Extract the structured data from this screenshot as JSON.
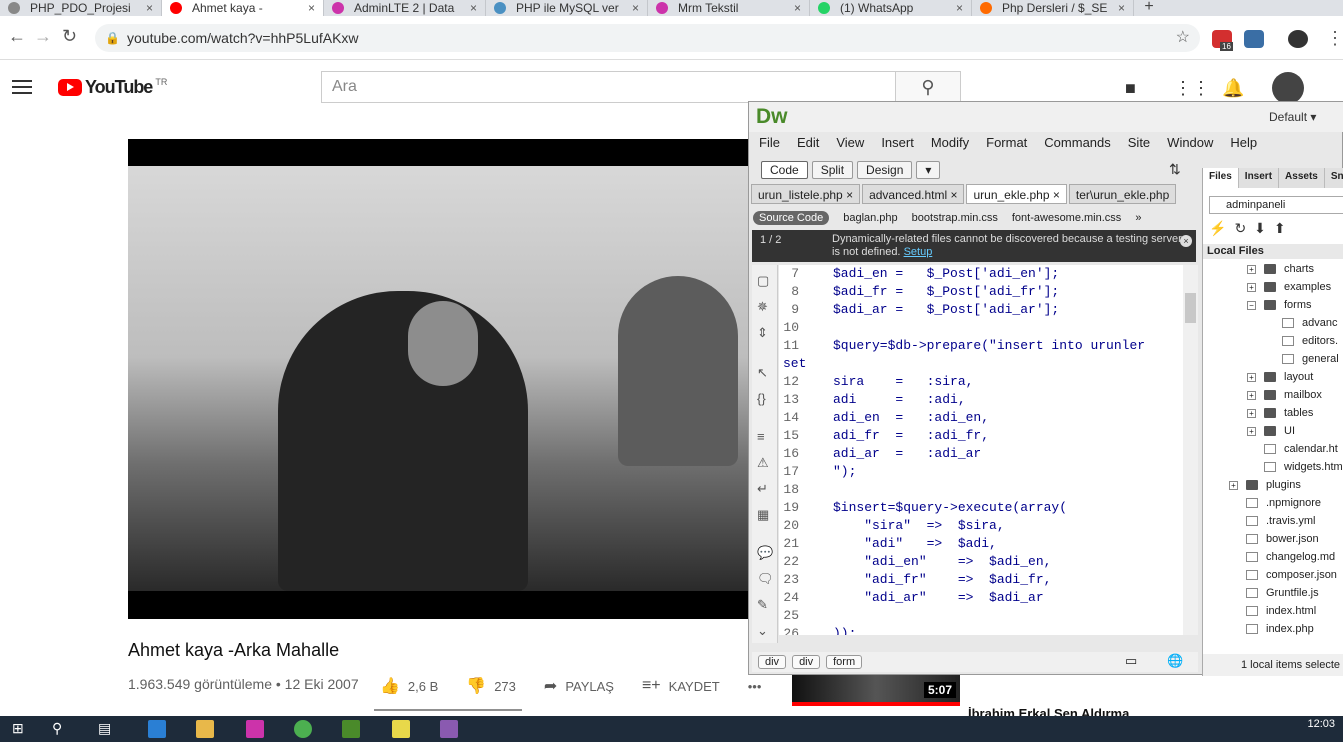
{
  "browser": {
    "tabs": [
      {
        "label": "PHP_PDO_Projesi",
        "color": "#888888",
        "active": false
      },
      {
        "label": "Ahmet kaya -",
        "color": "#ff0000",
        "active": true
      },
      {
        "label": "AdminLTE 2 | Data",
        "color": "#cc33aa",
        "active": false
      },
      {
        "label": "PHP ile MySQL ver",
        "color": "#4a90c2",
        "active": false
      },
      {
        "label": "Mrm Tekstil",
        "color": "#cc33aa",
        "active": false
      },
      {
        "label": "(1) WhatsApp",
        "color": "#25d366",
        "active": false
      },
      {
        "label": "Php Dersleri / $_SE",
        "color": "#ff6a00",
        "active": false
      }
    ],
    "new_tab": "+",
    "url": "youtube.com/watch?v=hhP5LufAKxw",
    "extension_badge": "16"
  },
  "youtube": {
    "logo": "YouTube",
    "country": "TR",
    "search_placeholder": "Ara",
    "video_title": "Ahmet kaya -Arka Mahalle",
    "views_date": "1.963.549 görüntüleme • 12 Eki 2007",
    "likes": "2,6 B",
    "dislikes": "273",
    "share": "PAYLAŞ",
    "save": "KAYDET",
    "more": "•••",
    "rec_duration": "5:07",
    "rec_title": "İbrahim Erkal Sen Aldırma"
  },
  "dreamweaver": {
    "logo": "Dw",
    "workspace": "Default",
    "menu": [
      "File",
      "Edit",
      "View",
      "Insert",
      "Modify",
      "Format",
      "Commands",
      "Site",
      "Window",
      "Help"
    ],
    "views": [
      "Code",
      "Split",
      "Design"
    ],
    "file_tabs": [
      "urun_listele.php",
      "advanced.html",
      "urun_ekle.php",
      "ter\\urun_ekle.php"
    ],
    "source_code": "Source Code",
    "related_files": [
      "baglan.php",
      "bootstrap.min.css",
      "font-awesome.min.css"
    ],
    "info_page": "1 / 2",
    "info_text": "Dynamically-related files cannot be discovered because a testing server is not defined.",
    "info_link": "Setup",
    "code_lines": [
      {
        "n": "7",
        "t": "$adi_en =   $_Post['adi_en'];"
      },
      {
        "n": "8",
        "t": "$adi_fr =   $_Post['adi_fr'];"
      },
      {
        "n": "9",
        "t": "$adi_ar =   $_Post['adi_ar'];"
      },
      {
        "n": "10",
        "t": ""
      },
      {
        "n": "11",
        "t": "$query=$db->prepare(\"insert into urunler"
      },
      {
        "n": "",
        "t": "set"
      },
      {
        "n": "12",
        "t": "sira    =   :sira,"
      },
      {
        "n": "13",
        "t": "adi     =   :adi,"
      },
      {
        "n": "14",
        "t": "adi_en  =   :adi_en,"
      },
      {
        "n": "15",
        "t": "adi_fr  =   :adi_fr,"
      },
      {
        "n": "16",
        "t": "adi_ar  =   :adi_ar"
      },
      {
        "n": "17",
        "t": "\");"
      },
      {
        "n": "18",
        "t": ""
      },
      {
        "n": "19",
        "t": "$insert=$query->execute(array("
      },
      {
        "n": "20",
        "t": "    \"sira\"  =>  $sira,"
      },
      {
        "n": "21",
        "t": "    \"adi\"   =>  $adi,"
      },
      {
        "n": "22",
        "t": "    \"adi_en\"    =>  $adi_en,"
      },
      {
        "n": "23",
        "t": "    \"adi_fr\"    =>  $adi_fr,"
      },
      {
        "n": "24",
        "t": "    \"adi_ar\"    =>  $adi_ar"
      },
      {
        "n": "25",
        "t": ""
      },
      {
        "n": "26",
        "t": "));"
      }
    ],
    "tag_path": [
      "div",
      "div",
      "form"
    ],
    "panel_tabs": [
      "Files",
      "Insert",
      "Assets",
      "Sni"
    ],
    "site": "adminpaneli",
    "local_files": "Local Files",
    "tree": [
      {
        "label": "charts",
        "type": "folder",
        "indent": 1,
        "exp": "+"
      },
      {
        "label": "examples",
        "type": "folder",
        "indent": 1,
        "exp": "+"
      },
      {
        "label": "forms",
        "type": "folder",
        "indent": 1,
        "exp": "−"
      },
      {
        "label": "advanc",
        "type": "file",
        "indent": 2,
        "exp": ""
      },
      {
        "label": "editors.",
        "type": "file",
        "indent": 2,
        "exp": ""
      },
      {
        "label": "general",
        "type": "file",
        "indent": 2,
        "exp": ""
      },
      {
        "label": "layout",
        "type": "folder",
        "indent": 1,
        "exp": "+"
      },
      {
        "label": "mailbox",
        "type": "folder",
        "indent": 1,
        "exp": "+"
      },
      {
        "label": "tables",
        "type": "folder",
        "indent": 1,
        "exp": "+"
      },
      {
        "label": "UI",
        "type": "folder",
        "indent": 1,
        "exp": "+"
      },
      {
        "label": "calendar.ht",
        "type": "file",
        "indent": 1,
        "exp": ""
      },
      {
        "label": "widgets.htm",
        "type": "file",
        "indent": 1,
        "exp": ""
      },
      {
        "label": "plugins",
        "type": "folder",
        "indent": 0,
        "exp": "+"
      },
      {
        "label": ".npmignore",
        "type": "file",
        "indent": 0,
        "exp": ""
      },
      {
        "label": ".travis.yml",
        "type": "file",
        "indent": 0,
        "exp": ""
      },
      {
        "label": "bower.json",
        "type": "file",
        "indent": 0,
        "exp": ""
      },
      {
        "label": "changelog.md",
        "type": "file",
        "indent": 0,
        "exp": ""
      },
      {
        "label": "composer.json",
        "type": "file",
        "indent": 0,
        "exp": ""
      },
      {
        "label": "Gruntfile.js",
        "type": "file",
        "indent": 0,
        "exp": ""
      },
      {
        "label": "index.html",
        "type": "file",
        "indent": 0,
        "exp": ""
      },
      {
        "label": "index.php",
        "type": "file",
        "indent": 0,
        "exp": ""
      }
    ],
    "panel_status": "1 local items selecte"
  },
  "taskbar": {
    "time": "12:03"
  }
}
